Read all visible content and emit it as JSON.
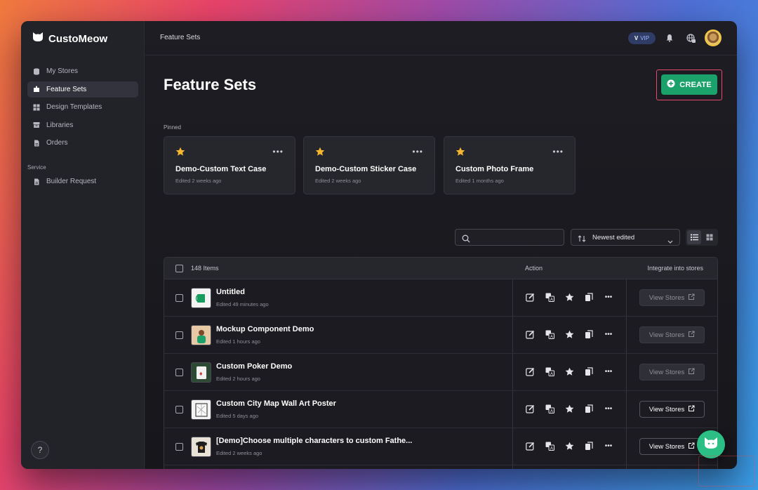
{
  "app": {
    "name": "CustoMeow"
  },
  "sidebar": {
    "items": [
      {
        "label": "My Stores",
        "icon": "database-icon"
      },
      {
        "label": "Feature Sets",
        "icon": "puzzle-icon",
        "active": true
      },
      {
        "label": "Design Templates",
        "icon": "grid-icon"
      },
      {
        "label": "Libraries",
        "icon": "archive-icon"
      },
      {
        "label": "Orders",
        "icon": "document-icon"
      }
    ],
    "section_label": "Service",
    "service_items": [
      {
        "label": "Builder Request",
        "icon": "document-icon"
      }
    ],
    "help": "?"
  },
  "topbar": {
    "breadcrumb": "Feature Sets",
    "vip_label": "VIP",
    "vip_mark": "V"
  },
  "page": {
    "title": "Feature Sets",
    "create_label": "CREATE"
  },
  "pinned": {
    "label": "Pinned",
    "cards": [
      {
        "name": "Demo-Custom Text Case",
        "sub": "Edited 2 weeks ago"
      },
      {
        "name": "Demo-Custom Sticker Case",
        "sub": "Edited 2 weeks ago"
      },
      {
        "name": "Custom Photo Frame",
        "sub": "Edited 1 months ago"
      }
    ]
  },
  "toolbar": {
    "search_placeholder": "",
    "sort_value": "Newest edited"
  },
  "table": {
    "count": "148 Items",
    "col_action": "Action",
    "col_integrate": "Integrate into stores",
    "view_stores_label": "View Stores",
    "rows": [
      {
        "name": "Untitled",
        "sub": "Edited 49 minutes ago",
        "view_enabled": false
      },
      {
        "name": "Mockup Component Demo",
        "sub": "Edited 1 hours ago",
        "view_enabled": false
      },
      {
        "name": "Custom Poker Demo",
        "sub": "Edited 2 hours ago",
        "view_enabled": false
      },
      {
        "name": "Custom City Map Wall Art Poster",
        "sub": "Edited 5 days ago",
        "view_enabled": true
      },
      {
        "name": "[Demo]Choose multiple characters to custom Fathe...",
        "sub": "Edited 2 weeks ago",
        "view_enabled": true
      }
    ]
  },
  "colors": {
    "accent": "#1aa26a",
    "highlight": "#e54a6a",
    "star": "#f5b82e"
  }
}
